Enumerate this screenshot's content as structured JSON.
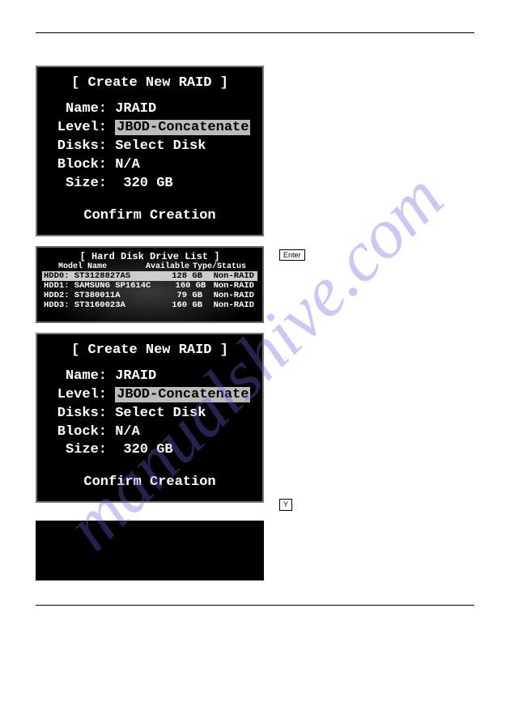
{
  "watermark": "manualshive.com",
  "bios1": {
    "title": "[ Create New RAID ]",
    "rows": {
      "name_label": "Name:",
      "name_value": "JRAID",
      "level_label": "Level:",
      "level_value": "JBOD-Concatenate",
      "disks_label": "Disks:",
      "disks_value": "Select Disk",
      "block_label": "Block:",
      "block_value": "N/A",
      "size_label": "Size:",
      "size_value": " 320 GB"
    },
    "confirm": "Confirm Creation"
  },
  "hdd": {
    "title": "[ Hard Disk Drive List ]",
    "header": {
      "c1": "Model Name",
      "c2": "Available",
      "c3": "Type/Status"
    },
    "rows": [
      {
        "c1": "HDD0: ST3128827AS",
        "c2": "128 GB",
        "c3": "Non-RAID",
        "selected": true
      },
      {
        "c1": "HDD1: SAMSUNG SP1614C",
        "c2": "160 GB",
        "c3": "Non-RAID",
        "selected": false
      },
      {
        "c1": "HDD2: ST380011A",
        "c2": "79 GB",
        "c3": "Non-RAID",
        "selected": false
      },
      {
        "c1": "HDD3: ST3160023A",
        "c2": "160 GB",
        "c3": "Non-RAID",
        "selected": false
      }
    ]
  },
  "bios2": {
    "title": "[ Create New RAID ]",
    "rows": {
      "name_label": "Name:",
      "name_value": "JRAID",
      "level_label": "Level:",
      "level_value": "JBOD-Concatenate",
      "disks_label": "Disks:",
      "disks_value": "Select Disk",
      "block_label": "Block:",
      "block_value": "N/A",
      "size_label": "Size:",
      "size_value": " 320 GB"
    },
    "confirm": "Confirm Creation"
  },
  "key1": "Enter",
  "key2": "Y"
}
